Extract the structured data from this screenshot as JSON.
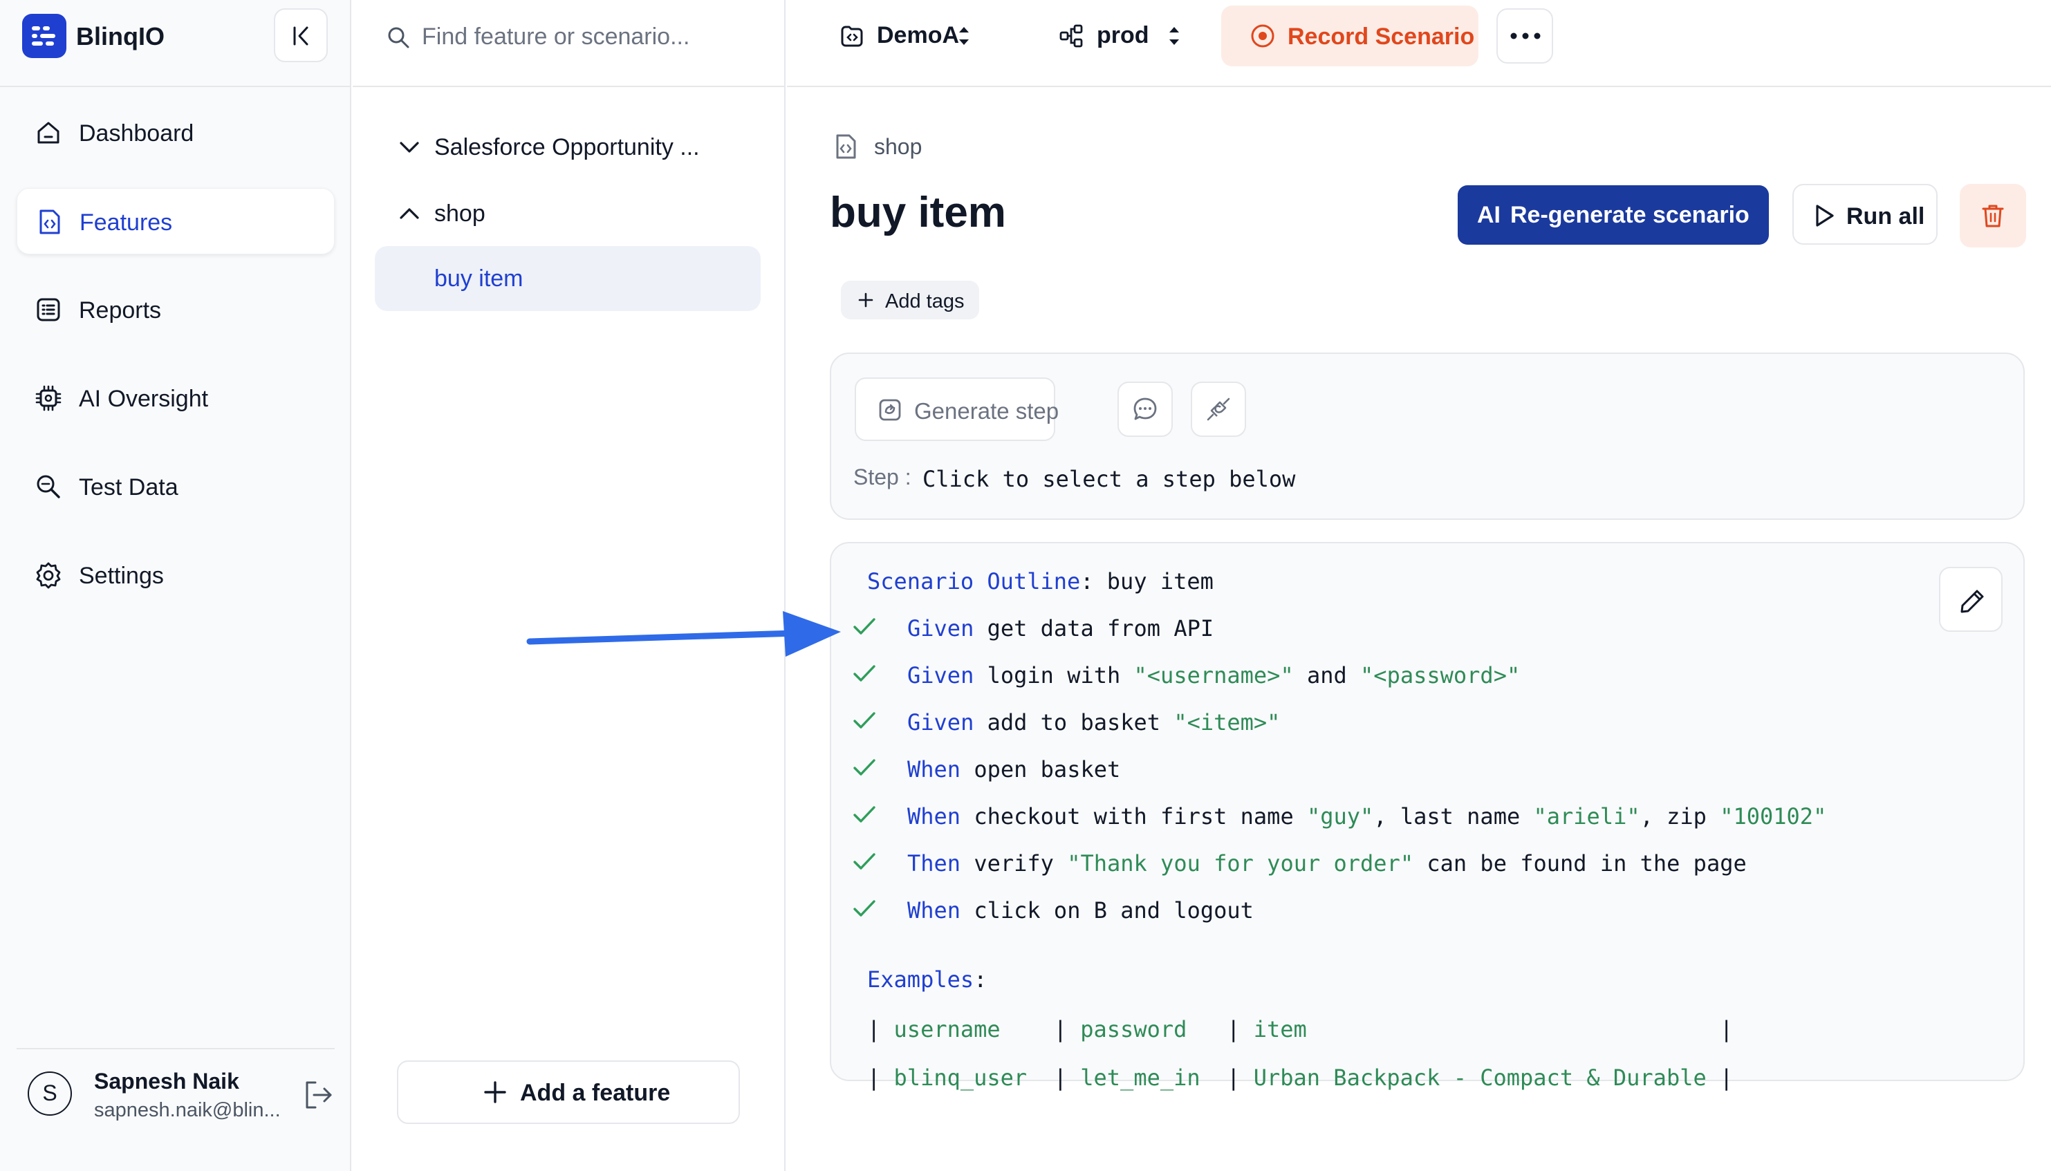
{
  "app": {
    "name": "BlinqIO",
    "brand_color": "#1f3fd1"
  },
  "sidebar": {
    "items": [
      {
        "label": "Dashboard",
        "icon": "home-icon"
      },
      {
        "label": "Features",
        "icon": "file-code-icon",
        "active": true
      },
      {
        "label": "Reports",
        "icon": "list-icon"
      },
      {
        "label": "AI Oversight",
        "icon": "cpu-icon"
      },
      {
        "label": "Test Data",
        "icon": "search-data-icon"
      },
      {
        "label": "Settings",
        "icon": "gear-icon"
      }
    ],
    "user": {
      "initial": "S",
      "name": "Sapnesh Naik",
      "email": "sapnesh.naik@blin..."
    }
  },
  "search": {
    "placeholder": "Find feature or scenario..."
  },
  "tree": {
    "features": [
      {
        "label": "Salesforce Opportunity ...",
        "expanded": false
      },
      {
        "label": "shop",
        "expanded": true,
        "scenarios": [
          {
            "label": "buy item",
            "selected": true
          }
        ]
      }
    ],
    "add_feature_label": "Add a feature"
  },
  "topbar": {
    "project": "DemoA",
    "environment": "prod",
    "record_label": "Record Scenario",
    "record_color": "#e0471c"
  },
  "main": {
    "breadcrumb": "shop",
    "title": "buy item",
    "regen_prefix": "AI",
    "regen_label": "Re-generate scenario",
    "run_label": "Run all",
    "add_tags_label": "Add tags",
    "generate_step_label": "Generate step",
    "step_prefix": "Step :",
    "step_text": "Click to select a step below"
  },
  "scenario": {
    "outline_keyword": "Scenario Outline",
    "outline_name": ": buy item",
    "steps": [
      {
        "status": "passed",
        "segments": [
          {
            "t": "kw",
            "v": "Given"
          },
          {
            "t": "txt",
            "v": " get data from API"
          }
        ]
      },
      {
        "status": "passed",
        "segments": [
          {
            "t": "kw",
            "v": "Given"
          },
          {
            "t": "txt",
            "v": " login with "
          },
          {
            "t": "str",
            "v": "\"<username>\""
          },
          {
            "t": "txt",
            "v": " and "
          },
          {
            "t": "str",
            "v": "\"<password>\""
          }
        ]
      },
      {
        "status": "passed",
        "segments": [
          {
            "t": "kw",
            "v": "Given"
          },
          {
            "t": "txt",
            "v": " add to basket "
          },
          {
            "t": "str",
            "v": "\"<item>\""
          }
        ]
      },
      {
        "status": "passed",
        "segments": [
          {
            "t": "kw",
            "v": "When"
          },
          {
            "t": "txt",
            "v": " open basket"
          }
        ]
      },
      {
        "status": "passed",
        "segments": [
          {
            "t": "kw",
            "v": "When"
          },
          {
            "t": "txt",
            "v": " checkout with first name "
          },
          {
            "t": "str",
            "v": "\"guy\""
          },
          {
            "t": "txt",
            "v": ", last name "
          },
          {
            "t": "str",
            "v": "\"arieli\""
          },
          {
            "t": "txt",
            "v": ", zip "
          },
          {
            "t": "str",
            "v": "\"100102\""
          }
        ]
      },
      {
        "status": "passed",
        "segments": [
          {
            "t": "kw",
            "v": "Then"
          },
          {
            "t": "txt",
            "v": " verify "
          },
          {
            "t": "str",
            "v": "\"Thank you for your order\""
          },
          {
            "t": "txt",
            "v": " can be found in the page"
          }
        ]
      },
      {
        "status": "passed",
        "segments": [
          {
            "t": "kw",
            "v": "When"
          },
          {
            "t": "txt",
            "v": " click on B and logout"
          }
        ]
      }
    ],
    "examples_keyword": "Examples",
    "examples_header": [
      "username",
      "password",
      "item"
    ],
    "examples_rows": [
      [
        "blinq_user",
        "let_me_in",
        "Urban Backpack - Compact & Durable"
      ]
    ],
    "pass_color": "#2e9e5b"
  }
}
